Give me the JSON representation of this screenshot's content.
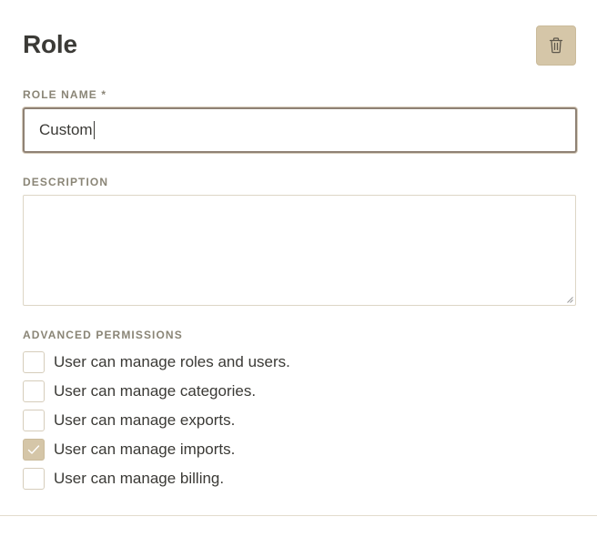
{
  "header": {
    "title": "Role",
    "delete_icon": "trash-icon"
  },
  "form": {
    "role_name": {
      "label": "ROLE NAME *",
      "value": "Custom"
    },
    "description": {
      "label": "DESCRIPTION",
      "value": ""
    },
    "permissions": {
      "label": "ADVANCED PERMISSIONS",
      "items": [
        {
          "label": "User can manage roles and users.",
          "checked": false
        },
        {
          "label": "User can manage categories.",
          "checked": false
        },
        {
          "label": "User can manage exports.",
          "checked": false
        },
        {
          "label": "User can manage imports.",
          "checked": true
        },
        {
          "label": "User can manage billing.",
          "checked": false
        }
      ]
    }
  },
  "colors": {
    "accent": "#d5c6a8",
    "text": "#3b3a36",
    "label": "#8a8576",
    "border": "#ddd6c6"
  }
}
